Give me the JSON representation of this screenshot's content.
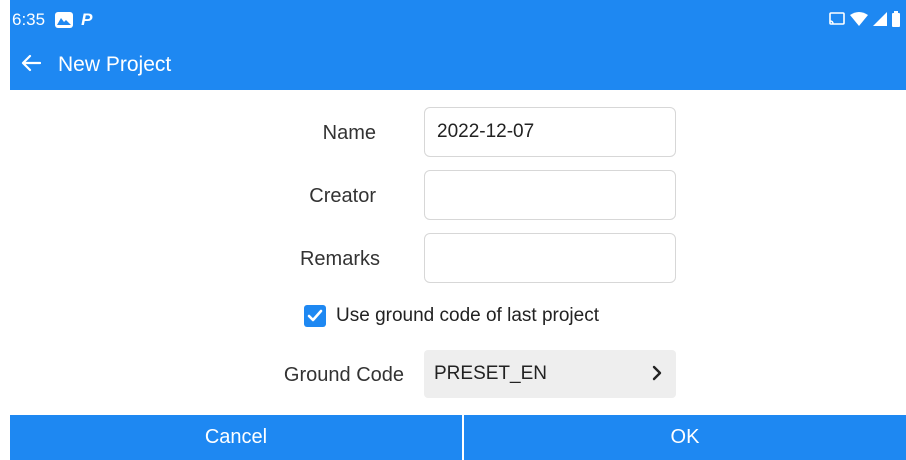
{
  "status_bar": {
    "time": "6:35",
    "notification_icons": [
      "gallery-icon",
      "p-icon"
    ],
    "notification_p": "P",
    "right_icons": [
      "cast-icon",
      "wifi-icon",
      "signal-icon",
      "battery-icon"
    ]
  },
  "app_bar": {
    "title": "New Project",
    "back_icon": "arrow-left-icon"
  },
  "form": {
    "name_label": "Name",
    "name_value": "2022-12-07",
    "creator_label": "Creator",
    "creator_value": "",
    "remarks_label": "Remarks",
    "remarks_value": "",
    "use_last_ground_code_label": "Use ground code of last project",
    "use_last_ground_code_checked": true,
    "ground_code_label": "Ground Code",
    "ground_code_value": "PRESET_EN"
  },
  "buttons": {
    "cancel": "Cancel",
    "ok": "OK"
  },
  "colors": {
    "primary": "#1e88f2",
    "input_border": "#d7d7d7",
    "select_bg": "#eeeeee"
  }
}
